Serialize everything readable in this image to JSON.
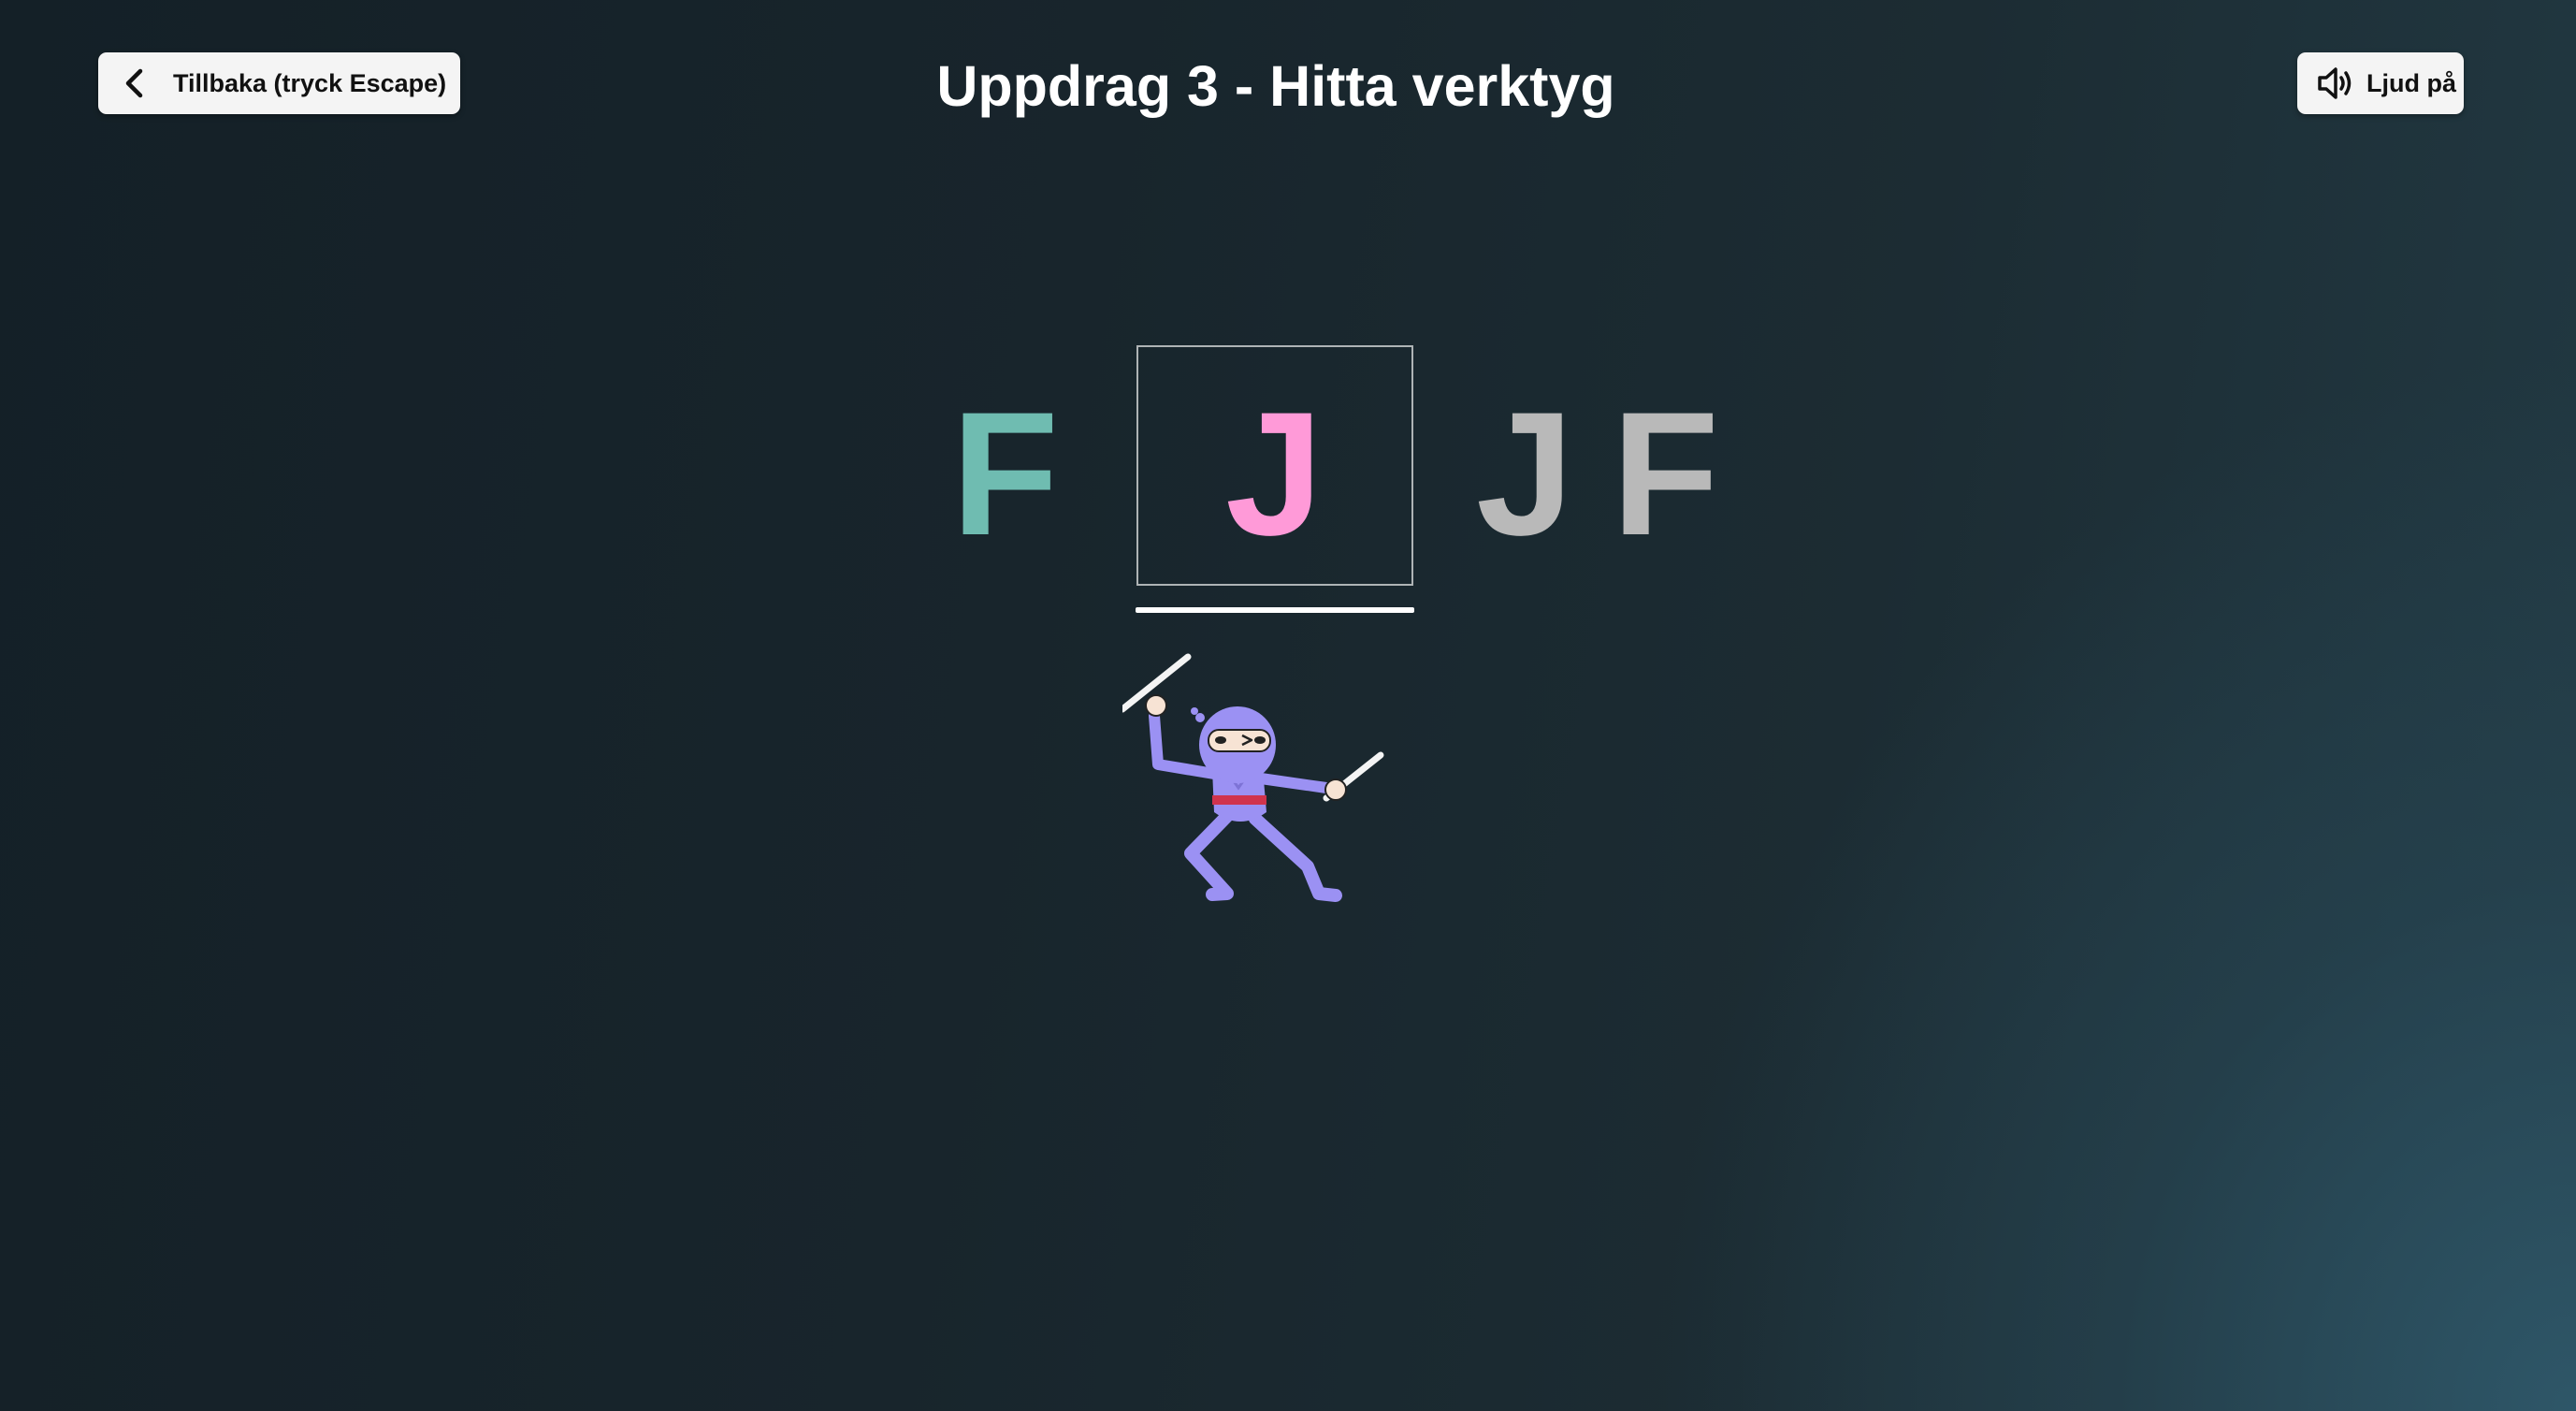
{
  "header": {
    "back_label": "Tillbaka (tryck Escape)",
    "title": "Uppdrag 3 - Hitta verktyg",
    "sound_label": "Ljud på"
  },
  "icons": {
    "back": "chevron-left-icon",
    "sound": "speaker-on-icon",
    "character": "ninja-illustration"
  },
  "sequence": {
    "letters": [
      {
        "char": "F",
        "state": "completed",
        "color": "#6fbcb1"
      },
      {
        "char": "J",
        "state": "current",
        "color": "#ff9ad8"
      },
      {
        "char": "J",
        "state": "upcoming",
        "color": "#b9b9b9"
      },
      {
        "char": "F",
        "state": "upcoming",
        "color": "#b9b9b9"
      }
    ]
  },
  "colors": {
    "background_dark": "#142027",
    "background_light": "#2f586a",
    "ninja_body": "#9b91f3",
    "ninja_belt": "#d0334d",
    "button_bg": "#f4f4f4"
  }
}
